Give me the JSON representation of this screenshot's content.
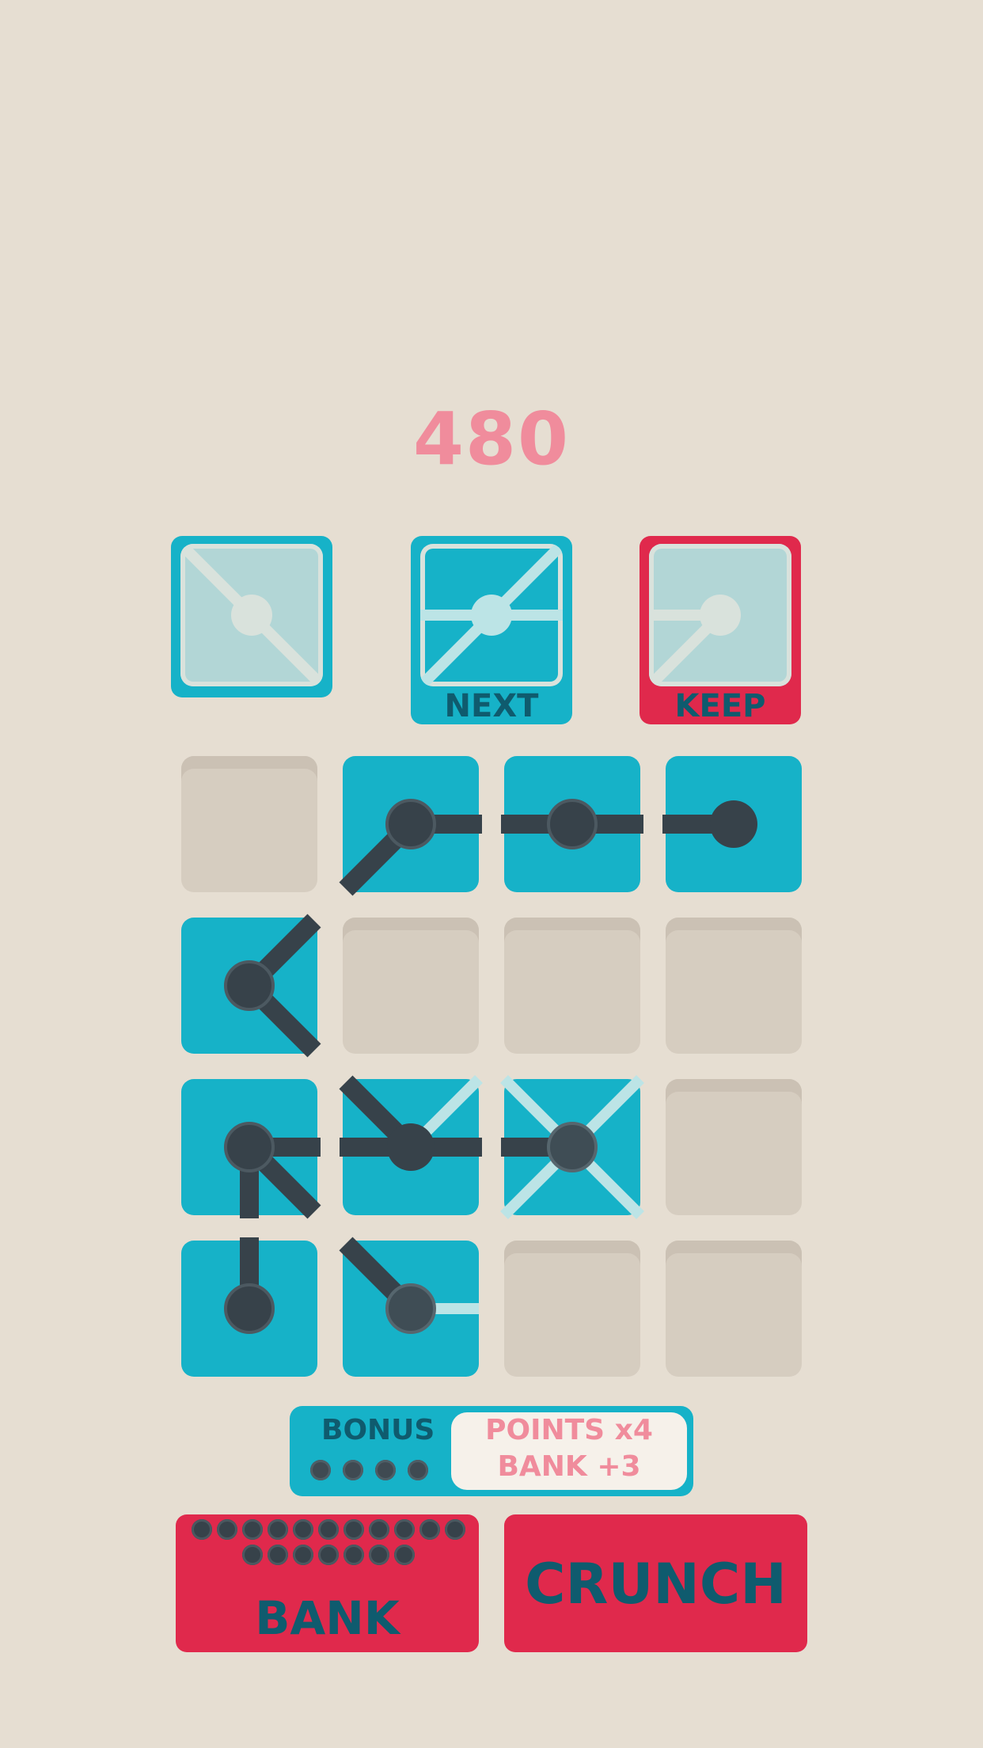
{
  "score": "480",
  "previews": [
    {
      "id": "current",
      "label": "",
      "color": "#16B2C8",
      "style": "faded-diag"
    },
    {
      "id": "next",
      "label": "NEXT",
      "color": "#16B2C8",
      "style": "x-cross"
    },
    {
      "id": "keep",
      "label": "KEEP",
      "color": "#E0294C",
      "style": "faded-west-sw"
    }
  ],
  "grid": [
    [
      "empty",
      "filled",
      "filled",
      "filled"
    ],
    [
      "filled",
      "empty",
      "empty",
      "empty"
    ],
    [
      "filled",
      "filled",
      "filled",
      "empty"
    ],
    [
      "filled",
      "filled",
      "empty",
      "empty"
    ]
  ],
  "bonus": {
    "label": "BONUS",
    "dots": 4,
    "points": "POINTS x4",
    "bank": "BANK +3"
  },
  "buttons": {
    "bank": "BANK",
    "crunch": "CRUNCH",
    "bank_dots": 18
  },
  "colors": {
    "background": "#E6DED2",
    "tile": "#16B2C8",
    "accent": "#E0294C",
    "score": "#F08C9C",
    "connector": "#37424A"
  }
}
